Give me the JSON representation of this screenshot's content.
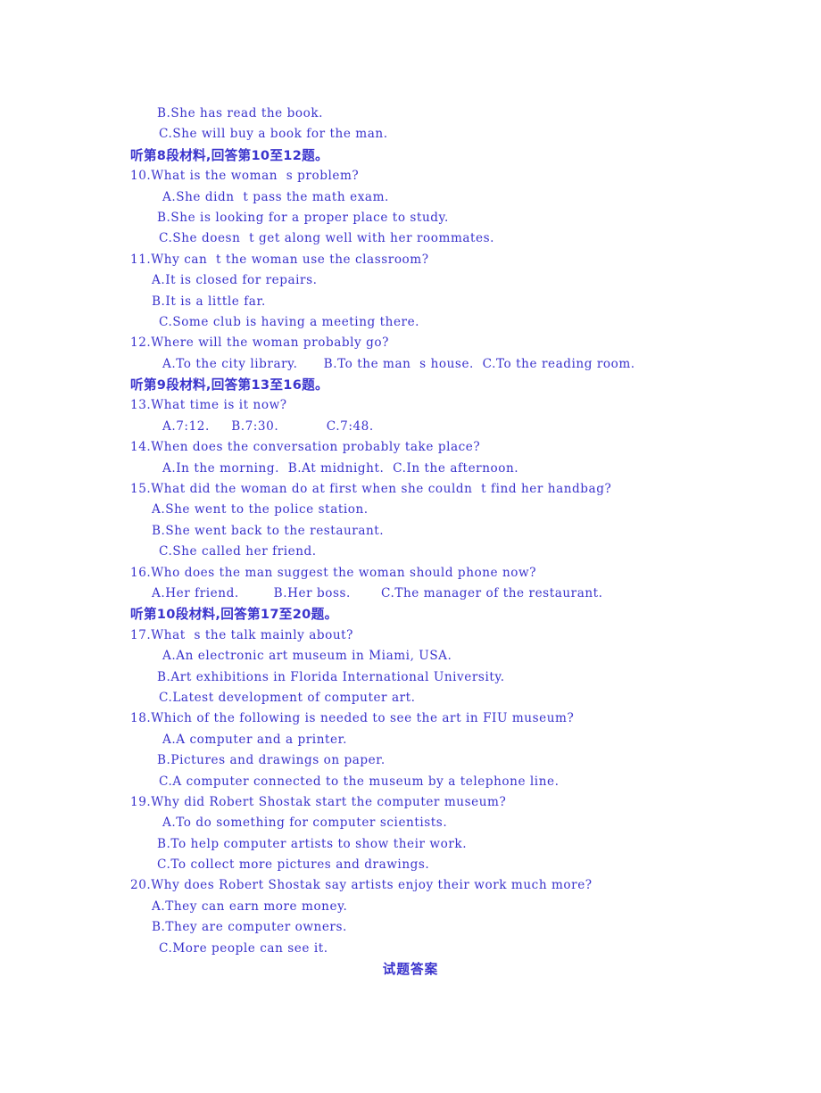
{
  "document": {
    "text_color": "#3a33cc",
    "background_color": "#ffffff",
    "footer": "试题答案"
  },
  "lines": [
    {
      "id": "l01",
      "text": "B.She has read the book.",
      "indent": 3,
      "lang": "en"
    },
    {
      "id": "l02",
      "text": "C.She will buy a book for the man.",
      "indent": 4,
      "lang": "en"
    },
    {
      "id": "l03",
      "text": "听第8段材料,回答第10至12题。",
      "indent": 0,
      "lang": "cn"
    },
    {
      "id": "l04",
      "text": "10.What is the woman  s problem?",
      "indent": 0,
      "lang": "en"
    },
    {
      "id": "l05",
      "text": "A.She didn  t pass the math exam.",
      "indent": 5,
      "lang": "en"
    },
    {
      "id": "l06",
      "text": "B.She is looking for a proper place to study.",
      "indent": 3,
      "lang": "en"
    },
    {
      "id": "l07",
      "text": "C.She doesn  t get along well with her roommates.",
      "indent": 4,
      "lang": "en"
    },
    {
      "id": "l08",
      "text": "11.Why can  t the woman use the classroom?",
      "indent": 0,
      "lang": "en"
    },
    {
      "id": "l09",
      "text": "A.It is closed for repairs.",
      "indent": 2,
      "lang": "en"
    },
    {
      "id": "l10",
      "text": "B.It is a little far.",
      "indent": 2,
      "lang": "en"
    },
    {
      "id": "l11",
      "text": "C.Some club is having a meeting there.",
      "indent": 4,
      "lang": "en"
    },
    {
      "id": "l12",
      "text": "12.Where will the woman probably go?",
      "indent": 0,
      "lang": "en"
    },
    {
      "id": "l13",
      "text": "A.To the city library.      B.To the man  s house.  C.To the reading room.",
      "indent": 5,
      "lang": "en"
    },
    {
      "id": "l14",
      "text": "听第9段材料,回答第13至16题。",
      "indent": 0,
      "lang": "cn"
    },
    {
      "id": "l15",
      "text": "13.What time is it now?",
      "indent": 0,
      "lang": "en"
    },
    {
      "id": "l16",
      "text": "A.7:12.     B.7:30.           C.7:48.",
      "indent": 5,
      "lang": "en"
    },
    {
      "id": "l17",
      "text": "14.When does the conversation probably take place?",
      "indent": 0,
      "lang": "en"
    },
    {
      "id": "l18",
      "text": "A.In the morning.  B.At midnight.  C.In the afternoon.",
      "indent": 5,
      "lang": "en"
    },
    {
      "id": "l19",
      "text": "15.What did the woman do at first when she couldn  t find her handbag?",
      "indent": 0,
      "lang": "en"
    },
    {
      "id": "l20",
      "text": "A.She went to the police station.",
      "indent": 2,
      "lang": "en"
    },
    {
      "id": "l21",
      "text": "B.She went back to the restaurant.",
      "indent": 2,
      "lang": "en"
    },
    {
      "id": "l22",
      "text": "C.She called her friend.",
      "indent": 4,
      "lang": "en"
    },
    {
      "id": "l23",
      "text": "16.Who does the man suggest the woman should phone now?",
      "indent": 0,
      "lang": "en"
    },
    {
      "id": "l24",
      "text": "A.Her friend.        B.Her boss.       C.The manager of the restaurant.",
      "indent": 2,
      "lang": "en"
    },
    {
      "id": "l25",
      "text": "听第10段材料,回答第17至20题。",
      "indent": 0,
      "lang": "cn"
    },
    {
      "id": "l26",
      "text": "17.What  s the talk mainly about?",
      "indent": 0,
      "lang": "en"
    },
    {
      "id": "l27",
      "text": "A.An electronic art museum in Miami, USA.",
      "indent": 5,
      "lang": "en"
    },
    {
      "id": "l28",
      "text": "B.Art exhibitions in Florida International University.",
      "indent": 3,
      "lang": "en"
    },
    {
      "id": "l29",
      "text": "C.Latest development of computer art.",
      "indent": 4,
      "lang": "en"
    },
    {
      "id": "l30",
      "text": "18.Which of the following is needed to see the art in FIU museum?",
      "indent": 0,
      "lang": "en"
    },
    {
      "id": "l31",
      "text": "A.A computer and a printer.",
      "indent": 5,
      "lang": "en"
    },
    {
      "id": "l32",
      "text": "B.Pictures and drawings on paper.",
      "indent": 3,
      "lang": "en"
    },
    {
      "id": "l33",
      "text": "C.A computer connected to the museum by a telephone line.",
      "indent": 4,
      "lang": "en"
    },
    {
      "id": "l34",
      "text": "19.Why did Robert Shostak start the computer museum?",
      "indent": 0,
      "lang": "en"
    },
    {
      "id": "l35",
      "text": "A.To do something for computer scientists.",
      "indent": 5,
      "lang": "en"
    },
    {
      "id": "l36",
      "text": "B.To help computer artists to show their work.",
      "indent": 3,
      "lang": "en"
    },
    {
      "id": "l37",
      "text": "C.To collect more pictures and drawings.",
      "indent": 3,
      "lang": "en"
    },
    {
      "id": "l38",
      "text": "20.Why does Robert Shostak say artists enjoy their work much more?",
      "indent": 0,
      "lang": "en"
    },
    {
      "id": "l39",
      "text": "A.They can earn more money.",
      "indent": 2,
      "lang": "en"
    },
    {
      "id": "l40",
      "text": "B.They are computer owners.",
      "indent": 2,
      "lang": "en"
    },
    {
      "id": "l41",
      "text": "C.More people can see it.",
      "indent": 4,
      "lang": "en"
    }
  ]
}
